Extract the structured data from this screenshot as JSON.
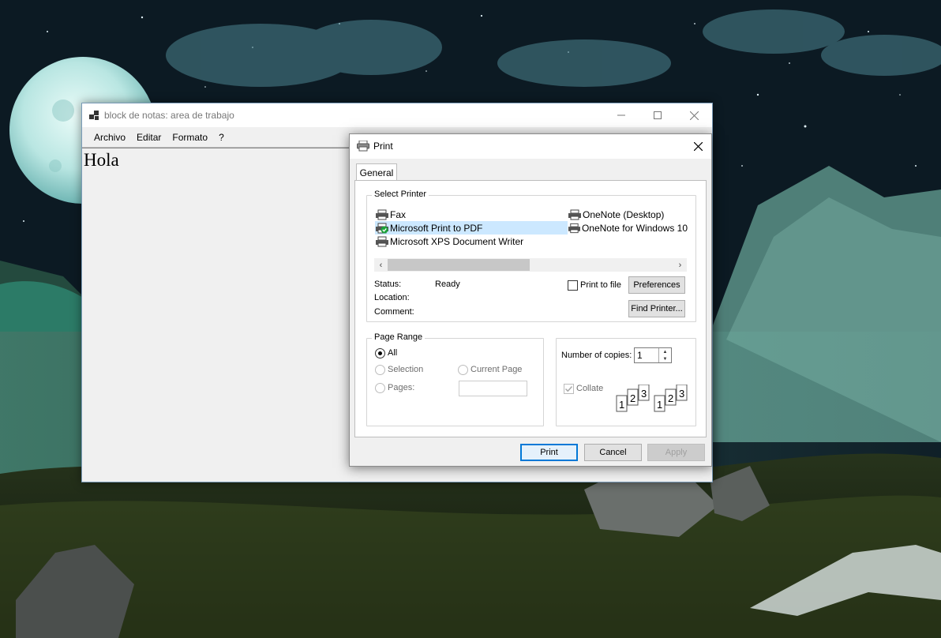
{
  "colors": {
    "selection": "#cce8ff",
    "accent": "#0078d7",
    "dialog_bg": "#f0f0f0"
  },
  "notepad": {
    "title": "block de notas: area de trabajo",
    "menu": [
      "Archivo",
      "Editar",
      "Formato",
      "?"
    ],
    "content": "Hola",
    "caption_icons": [
      "minimize-icon",
      "maximize-icon",
      "close-icon"
    ]
  },
  "print_dialog": {
    "title": "Print",
    "tab": "General",
    "select_printer": {
      "legend": "Select Printer",
      "printers": [
        {
          "name": "Fax",
          "icon": "printer-icon"
        },
        {
          "name": "Microsoft Print to PDF",
          "icon": "default-printer-icon",
          "selected": true
        },
        {
          "name": "Microsoft XPS Document Writer",
          "icon": "printer-icon"
        },
        {
          "name": "OneNote (Desktop)",
          "icon": "printer-icon"
        },
        {
          "name": "OneNote for Windows 10",
          "icon": "printer-icon"
        }
      ],
      "status_label": "Status:",
      "status_value": "Ready",
      "location_label": "Location:",
      "comment_label": "Comment:",
      "print_to_file": "Print to file",
      "preferences": "Preferences",
      "find_printer": "Find Printer..."
    },
    "page_range": {
      "legend": "Page Range",
      "all": "All",
      "selection": "Selection",
      "current_page": "Current Page",
      "pages": "Pages:",
      "pages_value": ""
    },
    "copies": {
      "label": "Number of copies:",
      "value": "1",
      "collate": "Collate"
    },
    "buttons": {
      "print": "Print",
      "cancel": "Cancel",
      "apply": "Apply"
    }
  }
}
